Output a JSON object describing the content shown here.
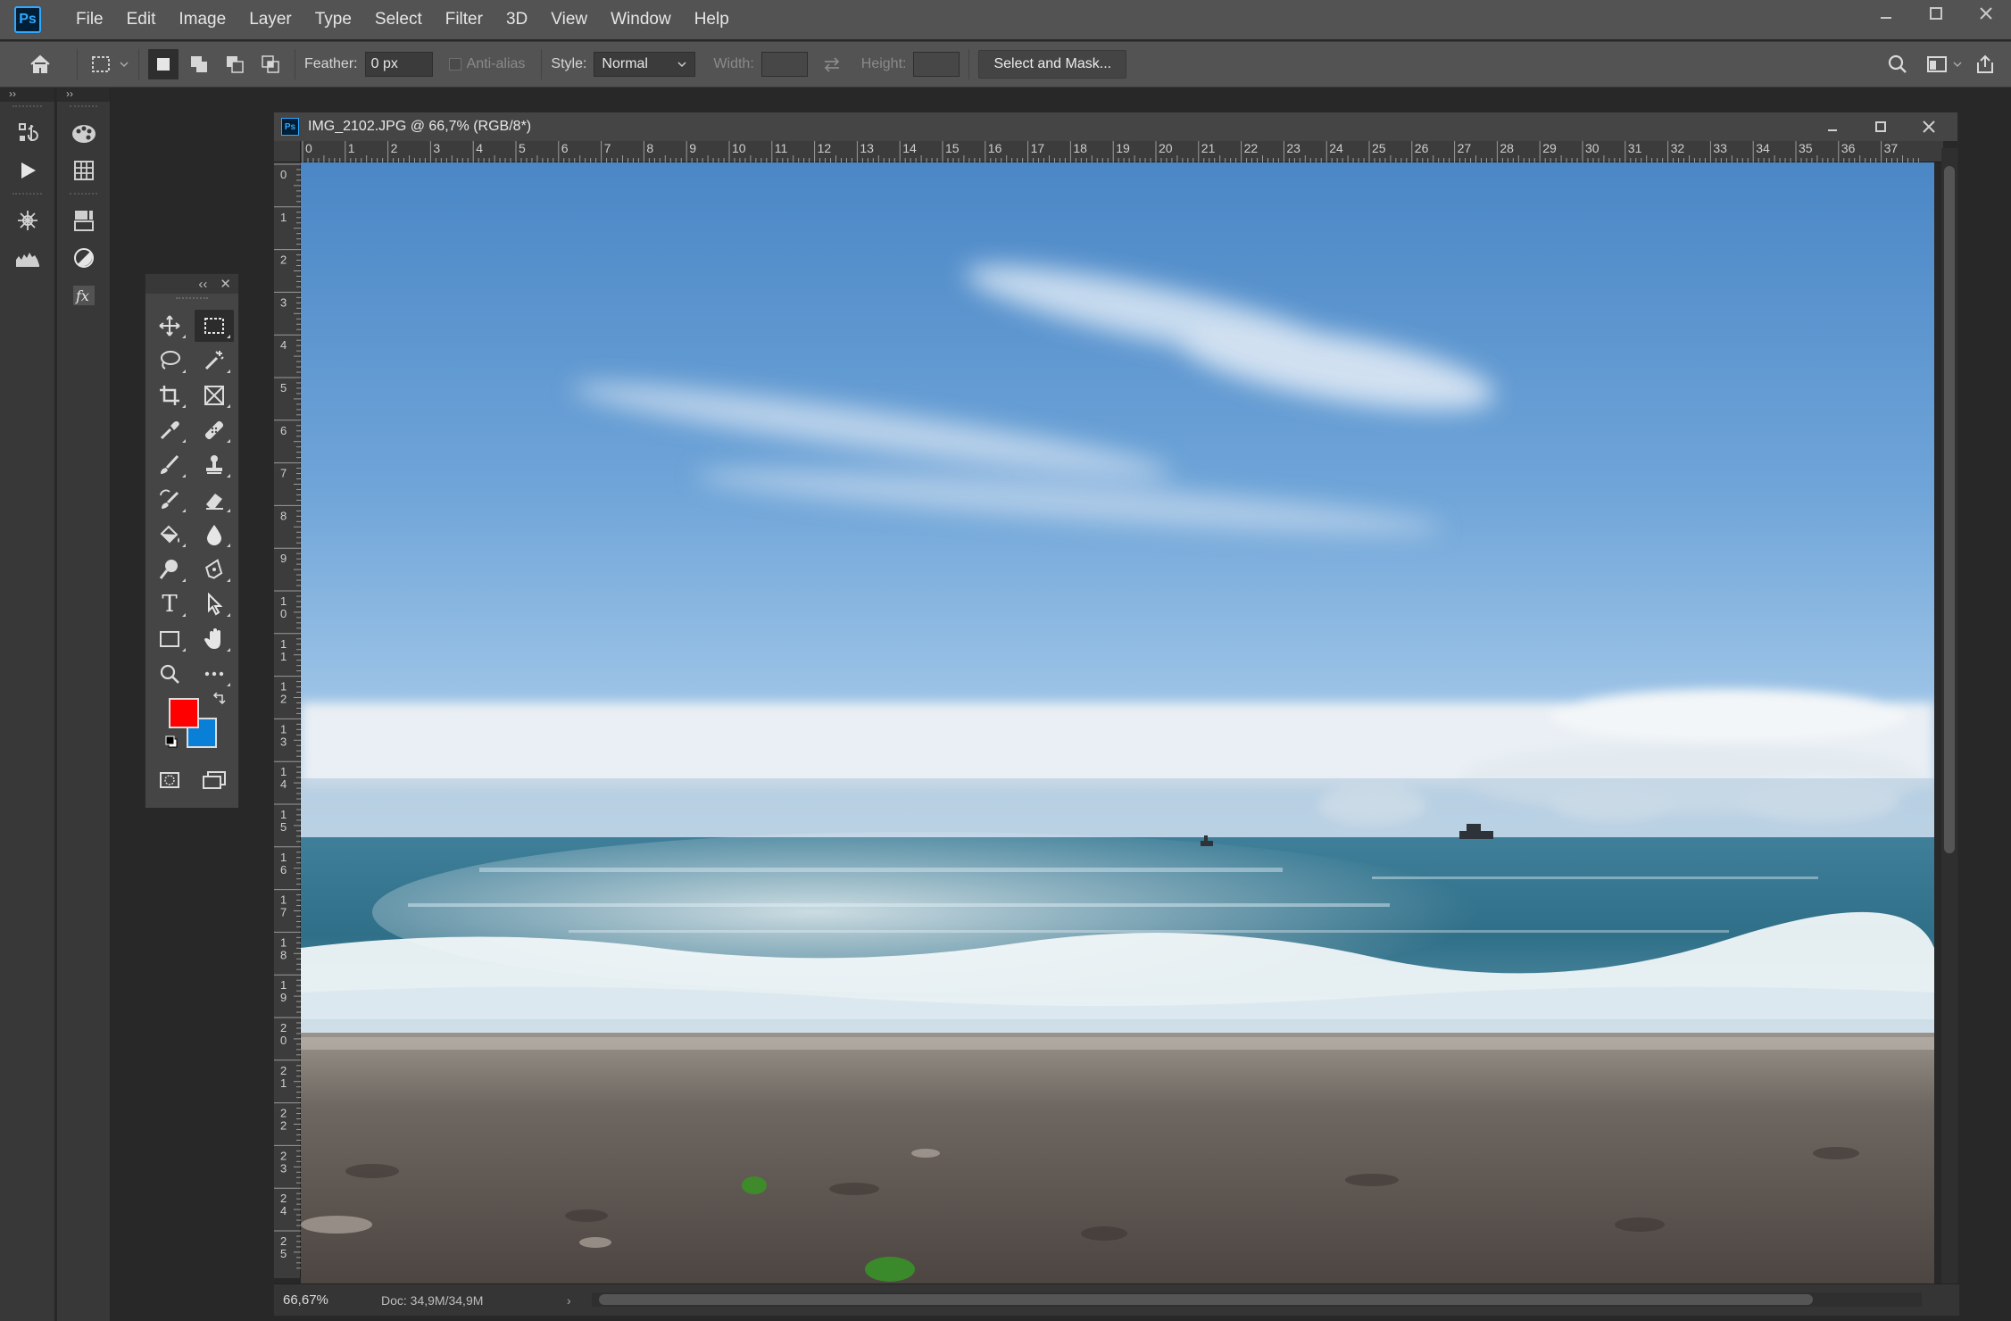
{
  "app": {
    "logo": "Ps"
  },
  "menu": [
    "File",
    "Edit",
    "Image",
    "Layer",
    "Type",
    "Select",
    "Filter",
    "3D",
    "View",
    "Window",
    "Help"
  ],
  "options": {
    "feather_label": "Feather:",
    "feather_value": "0 px",
    "antialias_label": "Anti-alias",
    "style_label": "Style:",
    "style_value": "Normal",
    "width_label": "Width:",
    "height_label": "Height:",
    "select_mask_label": "Select and Mask..."
  },
  "document": {
    "title": "IMG_2102.JPG @ 66,7% (RGB/8*)",
    "zoom": "66,67%",
    "doc_info": "Doc: 34,9M/34,9M"
  },
  "colors": {
    "foreground": "#ff0000",
    "background": "#0a7fd8"
  },
  "ruler": {
    "h_labels": [
      "0",
      "1",
      "2",
      "3",
      "4",
      "5",
      "6",
      "7",
      "8",
      "9",
      "10",
      "11",
      "12",
      "13",
      "14",
      "15",
      "16",
      "17",
      "18",
      "19",
      "20",
      "21",
      "22",
      "23",
      "24",
      "25",
      "26",
      "27",
      "28",
      "29",
      "30",
      "31",
      "32",
      "33",
      "34",
      "35",
      "36",
      "37"
    ],
    "v_labels": [
      "0",
      "1",
      "2",
      "3",
      "4",
      "5",
      "6",
      "7",
      "8",
      "9",
      "10",
      "11",
      "12",
      "13",
      "14",
      "15",
      "16",
      "17",
      "18",
      "19",
      "20",
      "21",
      "22",
      "23",
      "24",
      "25"
    ]
  },
  "tools": [
    [
      "move-tool-icon",
      "rectangular-marquee-tool-icon"
    ],
    [
      "lasso-tool-icon",
      "magic-wand-tool-icon"
    ],
    [
      "crop-tool-icon",
      "frame-tool-icon"
    ],
    [
      "eyedropper-tool-icon",
      "healing-brush-tool-icon"
    ],
    [
      "brush-tool-icon",
      "clone-stamp-tool-icon"
    ],
    [
      "history-brush-tool-icon",
      "eraser-tool-icon"
    ],
    [
      "paint-bucket-tool-icon",
      "blur-tool-icon"
    ],
    [
      "dodge-tool-icon",
      "pen-tool-icon"
    ],
    [
      "type-tool-icon",
      "path-selection-tool-icon"
    ],
    [
      "rectangle-tool-icon",
      "hand-tool-icon"
    ],
    [
      "zoom-tool-icon",
      "more-tools-icon"
    ]
  ],
  "type_tool_glyph": "T"
}
